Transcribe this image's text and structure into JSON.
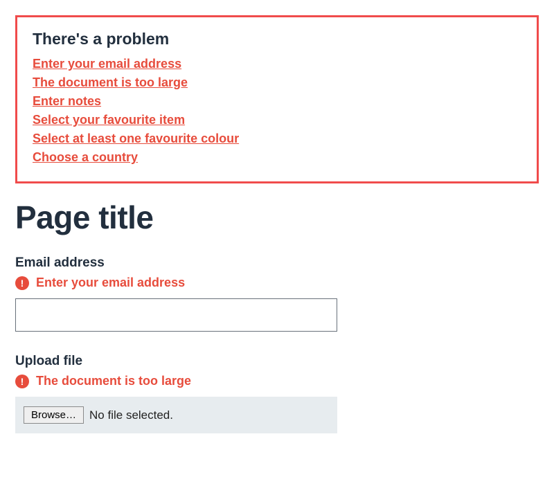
{
  "errorSummary": {
    "title": "There's a problem",
    "items": [
      "Enter your email address",
      "The document is too large",
      "Enter notes",
      "Select your favourite item",
      "Select at least one favourite colour",
      "Choose a country"
    ]
  },
  "page": {
    "title": "Page title"
  },
  "fields": {
    "email": {
      "label": "Email address",
      "error": "Enter your email address",
      "value": ""
    },
    "upload": {
      "label": "Upload file",
      "error": "The document is too large",
      "browseLabel": "Browse…",
      "status": "No file selected."
    }
  }
}
